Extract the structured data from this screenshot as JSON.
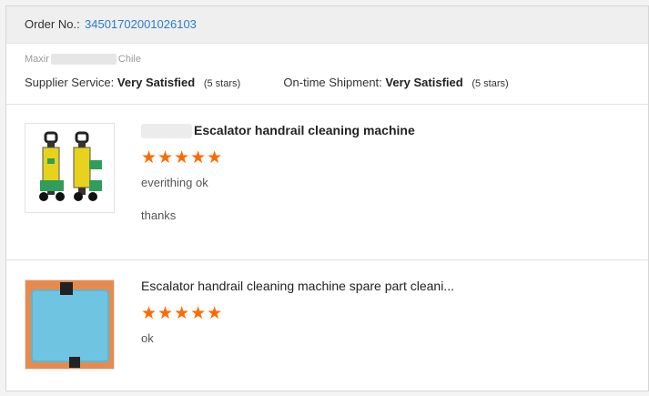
{
  "order": {
    "label": "Order No.:",
    "number": "34501702001026103"
  },
  "buyer": {
    "name_prefix": "Maxir",
    "country": "Chile"
  },
  "ratings": {
    "supplier_label": "Supplier Service:",
    "supplier_value": "Very Satisfied",
    "supplier_stars": "(5 stars)",
    "shipment_label": "On-time Shipment:",
    "shipment_value": "Very Satisfied",
    "shipment_stars": "(5 stars)"
  },
  "reviews": [
    {
      "title": "Escalator handrail cleaning machine",
      "stars_text": "★★★★★",
      "rating": 5,
      "comments": [
        "everithing ok",
        "thanks"
      ],
      "image_icon": "cleaning-machine-image"
    },
    {
      "title": "Escalator handrail cleaning machine spare part cleani...",
      "stars_text": "★★★★★",
      "rating": 5,
      "comments": [
        "ok"
      ],
      "image_icon": "microfiber-pad-image"
    }
  ],
  "colors": {
    "link": "#2a7bd0",
    "star": "#ff6a00",
    "header_bg": "#efefef"
  }
}
